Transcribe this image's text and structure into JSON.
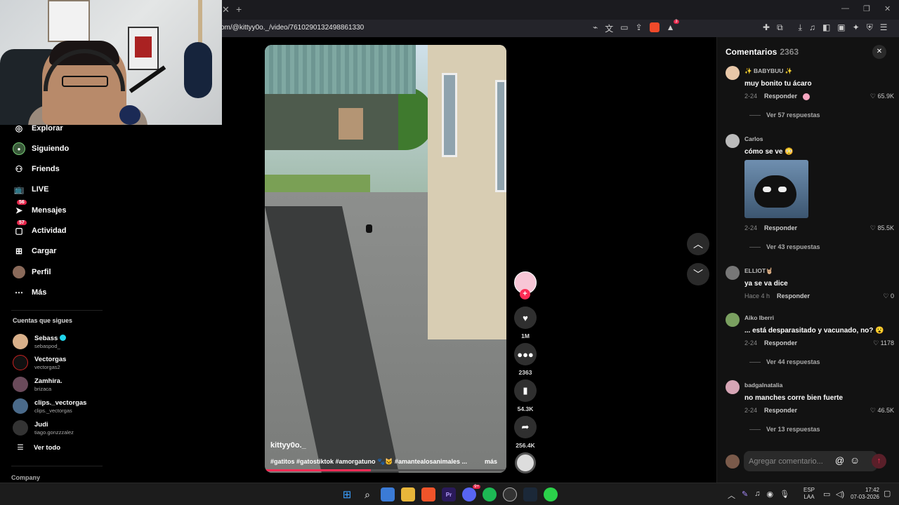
{
  "browser": {
    "url": "om/@kittyy0o._/video/7610290132498861330",
    "window_controls": [
      "—",
      "❐",
      "✕"
    ],
    "tab_close": "✕",
    "tab_new": "+",
    "ext_badge": "3"
  },
  "sidebar": {
    "items": [
      {
        "label": "Explorar",
        "icon": "compass-icon"
      },
      {
        "label": "Siguiendo",
        "icon": "following-icon"
      },
      {
        "label": "Friends",
        "icon": "friends-icon"
      },
      {
        "label": "LIVE",
        "icon": "live-tv-icon"
      },
      {
        "label": "Mensajes",
        "icon": "messages-icon",
        "badge": "56"
      },
      {
        "label": "Actividad",
        "icon": "activity-icon",
        "badge": "57"
      },
      {
        "label": "Cargar",
        "icon": "upload-icon"
      },
      {
        "label": "Perfil",
        "icon": "profile-icon"
      },
      {
        "label": "Más",
        "icon": "more-icon"
      }
    ],
    "following_header": "Cuentas que sigues",
    "accounts": [
      {
        "name": "Sebass",
        "handle": "sebaspod_",
        "verified": true
      },
      {
        "name": "Vectorgas",
        "handle": "vectorgas2"
      },
      {
        "name": "Zamhira.",
        "handle": "brizaca"
      },
      {
        "name": "clips._vectorgas",
        "handle": "clips._vectorgas"
      },
      {
        "name": "Judi",
        "handle": "tiago.gonzzzalez"
      }
    ],
    "see_all": "Ver todo",
    "company": "Company"
  },
  "video": {
    "author": "kittyy0o._",
    "caption": "#gatitos #gatostiktok #amorgatuno 🐾🐱 #amantealosanimales ...",
    "more": "más",
    "progress": 0.44
  },
  "actions": {
    "follow_plus": "+",
    "likes": "1M",
    "comments": "2363",
    "saves": "54.3K",
    "shares": "256.4K"
  },
  "comments": {
    "title": "Comentarios",
    "count": "2363",
    "close": "✕",
    "reply_label": "Responder",
    "items": [
      {
        "user": "✨ BABYBUU ✨",
        "text": "muy bonito tu ácaro",
        "date": "2-24",
        "likes": "65.9K",
        "replies": "Ver 57 respuestas",
        "avatar_color": "#e8c7a8"
      },
      {
        "user": "Carlos",
        "text": "cómo se ve 😳",
        "date": "2-24",
        "likes": "85.5K",
        "replies": "Ver 43 respuestas",
        "avatar_color": "#bbbbbb"
      },
      {
        "user": "ELLIOT🤘🏼",
        "text": "ya se va dice",
        "date": "Hace 4 h",
        "likes": "0",
        "avatar_color": "#777777"
      },
      {
        "user": "Aiko Iberri",
        "text": "... está desparasitado y vacunado, no? 😮",
        "date": "2-24",
        "likes": "1178",
        "replies": "Ver 44 respuestas",
        "avatar_color": "#7aa060"
      },
      {
        "user": "badgalnatalia",
        "text": "no manches corre bien fuerte",
        "date": "2-24",
        "likes": "46.5K",
        "replies": "Ver 13 respuestas",
        "avatar_color": "#d6a5b5"
      }
    ],
    "input_placeholder": "Agregar comentario...",
    "at": "@",
    "emoji": "☺",
    "send": "↑"
  },
  "taskbar": {
    "lang_top": "ESP",
    "lang_bottom": "LAA",
    "time": "17:42",
    "date": "07-03-2026",
    "discord_badge": "9+"
  },
  "colors": {
    "accent": "#fe2c55",
    "panel": "#121212"
  }
}
